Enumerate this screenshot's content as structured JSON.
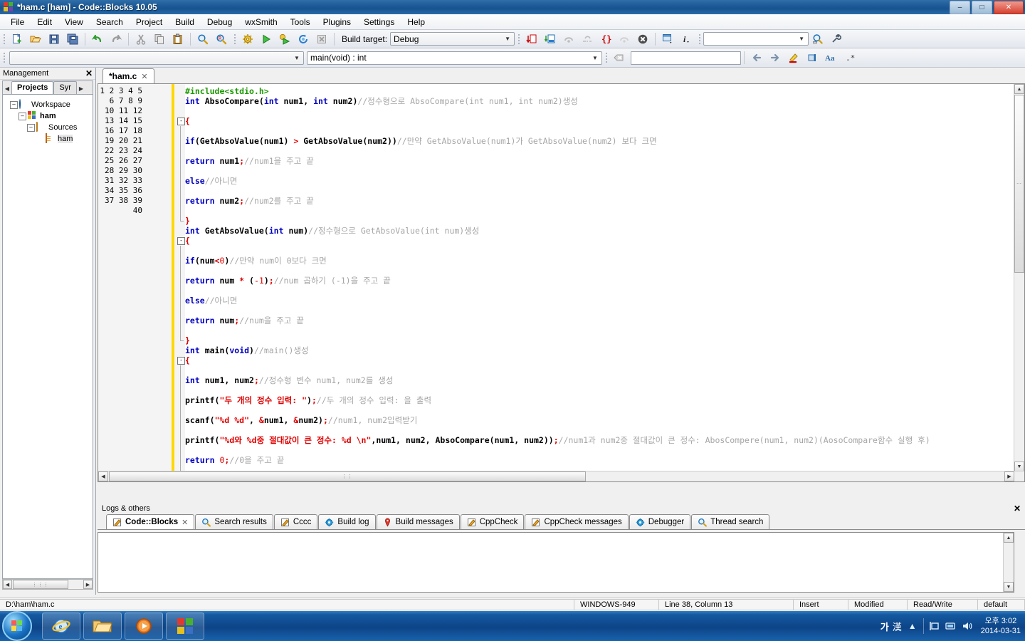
{
  "window": {
    "title": "*ham.c [ham] - Code::Blocks 10.05",
    "minimize": "–",
    "maximize": "□",
    "close": "✕"
  },
  "menubar": {
    "items": [
      "File",
      "Edit",
      "View",
      "Search",
      "Project",
      "Build",
      "Debug",
      "wxSmith",
      "Tools",
      "Plugins",
      "Settings",
      "Help"
    ]
  },
  "toolbar_main": {
    "build_target_label": "Build target:",
    "build_target_value": "Debug",
    "search_box_value": "",
    "icons": [
      "new-file-icon",
      "open-file-icon",
      "save-icon",
      "save-all-icon",
      "undo-icon",
      "redo-icon",
      "cut-icon",
      "copy-icon",
      "paste-icon",
      "find-icon",
      "replace-icon",
      "build-icon",
      "run-icon",
      "build-and-run-icon",
      "rebuild-icon",
      "abort-icon",
      "step-into-icon",
      "step-out-icon",
      "next-instruction-icon",
      "various-debug-icon",
      "debug-windows-icon",
      "stop-debugger-icon",
      "debugging-windows-icon",
      "info-icon",
      "search-icon",
      "settings-icon"
    ]
  },
  "toolbar_secondary": {
    "scope_value": "",
    "function_value": "main(void) : int",
    "goto_box_value": "",
    "icons": [
      "back-icon",
      "forward-icon",
      "highlight-icon",
      "toggle-icon",
      "match-case-icon",
      "regex-icon",
      "clear-icon"
    ]
  },
  "management": {
    "title": "Management",
    "close_label": "✕",
    "tabs": [
      {
        "label": "Projects",
        "active": true
      },
      {
        "label": "Syr",
        "active": false
      }
    ],
    "tree": [
      {
        "label": "Workspace",
        "icon": "globe-icon",
        "indent": 0,
        "expander": "-",
        "bold": false
      },
      {
        "label": "ham",
        "icon": "project-icon",
        "indent": 1,
        "expander": "-",
        "bold": true
      },
      {
        "label": "Sources",
        "icon": "folder-icon",
        "indent": 2,
        "expander": "-",
        "bold": false
      },
      {
        "label": "ham",
        "icon": "c-file-icon",
        "indent": 3,
        "expander": "",
        "bold": false
      }
    ]
  },
  "editor": {
    "tab": {
      "label": "*ham.c",
      "close": "✕"
    },
    "first_line": 1,
    "last_visible_line": 40,
    "lines": [
      {
        "n": 1,
        "fold": "",
        "tokens": [
          {
            "t": "#include<stdio.h>",
            "c": "pp"
          }
        ]
      },
      {
        "n": 2,
        "fold": "",
        "tokens": [
          {
            "t": "int ",
            "c": "kw"
          },
          {
            "t": "AbsoCompare",
            "c": "id"
          },
          {
            "t": "(",
            "c": "pn"
          },
          {
            "t": "int ",
            "c": "kw"
          },
          {
            "t": "num1",
            "c": "id"
          },
          {
            "t": ", ",
            "c": "pn"
          },
          {
            "t": "int ",
            "c": "kw"
          },
          {
            "t": "num2",
            "c": "id"
          },
          {
            "t": ")",
            "c": "pn"
          },
          {
            "t": "//정수형으로 AbsoCompare(int num1, int num2)생성",
            "c": "cm"
          }
        ]
      },
      {
        "n": 3,
        "fold": "",
        "tokens": []
      },
      {
        "n": 4,
        "fold": "-",
        "tokens": [
          {
            "t": "{",
            "c": "op"
          }
        ]
      },
      {
        "n": 5,
        "fold": "|",
        "tokens": []
      },
      {
        "n": 6,
        "fold": "|",
        "tokens": [
          {
            "t": "if",
            "c": "kw"
          },
          {
            "t": "(",
            "c": "pn"
          },
          {
            "t": "GetAbsoValue",
            "c": "id"
          },
          {
            "t": "(",
            "c": "pn"
          },
          {
            "t": "num1",
            "c": "id"
          },
          {
            "t": ") ",
            "c": "pn"
          },
          {
            "t": "> ",
            "c": "op"
          },
          {
            "t": "GetAbsoValue",
            "c": "id"
          },
          {
            "t": "(",
            "c": "pn"
          },
          {
            "t": "num2",
            "c": "id"
          },
          {
            "t": "))",
            "c": "pn"
          },
          {
            "t": "//만약 GetAbsoValue(num1)가 GetAbsoValue(num2) 보다 크면",
            "c": "cm"
          }
        ]
      },
      {
        "n": 7,
        "fold": "|",
        "tokens": []
      },
      {
        "n": 8,
        "fold": "|",
        "tokens": [
          {
            "t": "return ",
            "c": "kw"
          },
          {
            "t": "num1",
            "c": "id"
          },
          {
            "t": ";",
            "c": "op"
          },
          {
            "t": "//num1을 주고 끝",
            "c": "cm"
          }
        ]
      },
      {
        "n": 9,
        "fold": "|",
        "tokens": []
      },
      {
        "n": 10,
        "fold": "|",
        "tokens": [
          {
            "t": "else",
            "c": "kw"
          },
          {
            "t": "//아니면",
            "c": "cm"
          }
        ]
      },
      {
        "n": 11,
        "fold": "|",
        "tokens": []
      },
      {
        "n": 12,
        "fold": "|",
        "tokens": [
          {
            "t": "return ",
            "c": "kw"
          },
          {
            "t": "num2",
            "c": "id"
          },
          {
            "t": ";",
            "c": "op"
          },
          {
            "t": "//num2를 주고 끝",
            "c": "cm"
          }
        ]
      },
      {
        "n": 13,
        "fold": "|",
        "tokens": []
      },
      {
        "n": 14,
        "fold": "L",
        "tokens": [
          {
            "t": "}",
            "c": "op"
          }
        ]
      },
      {
        "n": 15,
        "fold": "",
        "tokens": [
          {
            "t": "int ",
            "c": "kw"
          },
          {
            "t": "GetAbsoValue",
            "c": "id"
          },
          {
            "t": "(",
            "c": "pn"
          },
          {
            "t": "int ",
            "c": "kw"
          },
          {
            "t": "num",
            "c": "id"
          },
          {
            "t": ")",
            "c": "pn"
          },
          {
            "t": "//정수형으로 GetAbsoValue(int num)생성",
            "c": "cm"
          }
        ]
      },
      {
        "n": 16,
        "fold": "-",
        "tokens": [
          {
            "t": "{",
            "c": "op"
          }
        ]
      },
      {
        "n": 17,
        "fold": "|",
        "tokens": []
      },
      {
        "n": 18,
        "fold": "|",
        "tokens": [
          {
            "t": "if",
            "c": "kw"
          },
          {
            "t": "(",
            "c": "pn"
          },
          {
            "t": "num",
            "c": "id"
          },
          {
            "t": "<",
            "c": "op"
          },
          {
            "t": "0",
            "c": "num"
          },
          {
            "t": ")",
            "c": "pn"
          },
          {
            "t": "//만약 num이 0보다 크면",
            "c": "cm"
          }
        ]
      },
      {
        "n": 19,
        "fold": "|",
        "tokens": []
      },
      {
        "n": 20,
        "fold": "|",
        "tokens": [
          {
            "t": "return ",
            "c": "kw"
          },
          {
            "t": "num ",
            "c": "id"
          },
          {
            "t": "* ",
            "c": "op"
          },
          {
            "t": "(",
            "c": "pn"
          },
          {
            "t": "-1",
            "c": "num"
          },
          {
            "t": ")",
            "c": "pn"
          },
          {
            "t": ";",
            "c": "op"
          },
          {
            "t": "//num 곱하기 (-1)을 주고 끝",
            "c": "cm"
          }
        ]
      },
      {
        "n": 21,
        "fold": "|",
        "tokens": []
      },
      {
        "n": 22,
        "fold": "|",
        "tokens": [
          {
            "t": "else",
            "c": "kw"
          },
          {
            "t": "//아니면",
            "c": "cm"
          }
        ]
      },
      {
        "n": 23,
        "fold": "|",
        "tokens": []
      },
      {
        "n": 24,
        "fold": "|",
        "tokens": [
          {
            "t": "return ",
            "c": "kw"
          },
          {
            "t": "num",
            "c": "id"
          },
          {
            "t": ";",
            "c": "op"
          },
          {
            "t": "//num을 주고 끝",
            "c": "cm"
          }
        ]
      },
      {
        "n": 25,
        "fold": "|",
        "tokens": []
      },
      {
        "n": 26,
        "fold": "L",
        "tokens": [
          {
            "t": "}",
            "c": "op"
          }
        ]
      },
      {
        "n": 27,
        "fold": "",
        "tokens": [
          {
            "t": "int ",
            "c": "kw"
          },
          {
            "t": "main",
            "c": "id"
          },
          {
            "t": "(",
            "c": "pn"
          },
          {
            "t": "void",
            "c": "kw"
          },
          {
            "t": ")",
            "c": "pn"
          },
          {
            "t": "//main()생성",
            "c": "cm"
          }
        ]
      },
      {
        "n": 28,
        "fold": "-",
        "tokens": [
          {
            "t": "{",
            "c": "op"
          }
        ]
      },
      {
        "n": 29,
        "fold": "|",
        "tokens": []
      },
      {
        "n": 30,
        "fold": "|",
        "tokens": [
          {
            "t": "int ",
            "c": "kw"
          },
          {
            "t": "num1",
            "c": "id"
          },
          {
            "t": ", ",
            "c": "pn"
          },
          {
            "t": "num2",
            "c": "id"
          },
          {
            "t": ";",
            "c": "op"
          },
          {
            "t": "//정수형 변수 num1, num2를 생성",
            "c": "cm"
          }
        ]
      },
      {
        "n": 31,
        "fold": "|",
        "tokens": []
      },
      {
        "n": 32,
        "fold": "|",
        "tokens": [
          {
            "t": "printf",
            "c": "id"
          },
          {
            "t": "(",
            "c": "pn"
          },
          {
            "t": "\"두 개의 정수 입력: \"",
            "c": "str"
          },
          {
            "t": ")",
            "c": "pn"
          },
          {
            "t": ";",
            "c": "op"
          },
          {
            "t": "//두 개의 정수 입력: 을 출력",
            "c": "cm"
          }
        ]
      },
      {
        "n": 33,
        "fold": "|",
        "tokens": []
      },
      {
        "n": 34,
        "fold": "|",
        "tokens": [
          {
            "t": "scanf",
            "c": "id"
          },
          {
            "t": "(",
            "c": "pn"
          },
          {
            "t": "\"%d %d\"",
            "c": "str"
          },
          {
            "t": ", ",
            "c": "pn"
          },
          {
            "t": "&",
            "c": "op"
          },
          {
            "t": "num1",
            "c": "id"
          },
          {
            "t": ", ",
            "c": "pn"
          },
          {
            "t": "&",
            "c": "op"
          },
          {
            "t": "num2",
            "c": "id"
          },
          {
            "t": ")",
            "c": "pn"
          },
          {
            "t": ";",
            "c": "op"
          },
          {
            "t": "//num1, num2입력받기",
            "c": "cm"
          }
        ]
      },
      {
        "n": 35,
        "fold": "|",
        "tokens": []
      },
      {
        "n": 36,
        "fold": "|",
        "tokens": [
          {
            "t": "printf",
            "c": "id"
          },
          {
            "t": "(",
            "c": "pn"
          },
          {
            "t": "\"%d와 %d중 절대값이 큰 정수: %d \\n\"",
            "c": "str"
          },
          {
            "t": ",",
            "c": "pn"
          },
          {
            "t": "num1",
            "c": "id"
          },
          {
            "t": ", ",
            "c": "pn"
          },
          {
            "t": "num2",
            "c": "id"
          },
          {
            "t": ", ",
            "c": "pn"
          },
          {
            "t": "AbsoCompare",
            "c": "id"
          },
          {
            "t": "(",
            "c": "pn"
          },
          {
            "t": "num1",
            "c": "id"
          },
          {
            "t": ", ",
            "c": "pn"
          },
          {
            "t": "num2",
            "c": "id"
          },
          {
            "t": "))",
            "c": "pn"
          },
          {
            "t": ";",
            "c": "op"
          },
          {
            "t": "//num1과 num2중 절대값이 큰 정수: AbosCompere(num1, num2)(AosoCompare함수 실행 후)",
            "c": "cm"
          }
        ]
      },
      {
        "n": 37,
        "fold": "|",
        "tokens": []
      },
      {
        "n": 38,
        "fold": "|",
        "tokens": [
          {
            "t": "return ",
            "c": "kw"
          },
          {
            "t": "0",
            "c": "num"
          },
          {
            "t": ";",
            "c": "op"
          },
          {
            "t": "//0을 주고 끝",
            "c": "cm"
          }
        ]
      },
      {
        "n": 39,
        "fold": "|",
        "tokens": []
      },
      {
        "n": 40,
        "fold": "L",
        "tokens": [
          {
            "t": "}",
            "c": "op"
          }
        ]
      }
    ]
  },
  "logs": {
    "title": "Logs & others",
    "close_label": "✕",
    "tabs": [
      {
        "label": "Code::Blocks",
        "icon": "pencil-icon",
        "active": true,
        "closable": true
      },
      {
        "label": "Search results",
        "icon": "magnifier-icon",
        "active": false,
        "closable": false
      },
      {
        "label": "Cccc",
        "icon": "pencil-icon",
        "active": false,
        "closable": false
      },
      {
        "label": "Build log",
        "icon": "gear-blue-icon",
        "active": false,
        "closable": false
      },
      {
        "label": "Build messages",
        "icon": "pin-icon",
        "active": false,
        "closable": false
      },
      {
        "label": "CppCheck",
        "icon": "pencil-icon",
        "active": false,
        "closable": false
      },
      {
        "label": "CppCheck messages",
        "icon": "pencil-icon",
        "active": false,
        "closable": false
      },
      {
        "label": "Debugger",
        "icon": "gear-blue-icon",
        "active": false,
        "closable": false
      },
      {
        "label": "Thread search",
        "icon": "magnifier-icon",
        "active": false,
        "closable": false
      }
    ],
    "content": ""
  },
  "statusbar": {
    "path": "D:\\ham\\ham.c",
    "encoding": "WINDOWS-949",
    "position": "Line 38, Column 13",
    "insert_mode": "Insert",
    "modified": "Modified",
    "access": "Read/Write",
    "profile": "default"
  },
  "taskbar": {
    "start_label": "start-orb",
    "apps": [
      "internet-explorer-icon",
      "explorer-icon",
      "media-player-icon",
      "codeblocks-icon"
    ],
    "ime": {
      "korean": "가",
      "hanja": "漢"
    },
    "clock_time": "오후 3:02",
    "clock_date": "2014-03-31",
    "tray_icons": [
      "show-hidden-icon",
      "keyboard-icon",
      "network-icon",
      "volume-icon"
    ]
  },
  "colors": {
    "title_bar": "#1d5a97",
    "keyword": "#0000c0",
    "preprocessor": "#1a9900",
    "string": "#e00000",
    "comment": "#a6a6a6",
    "change_bar": "#ffd800",
    "taskbar": "#0d4487"
  }
}
